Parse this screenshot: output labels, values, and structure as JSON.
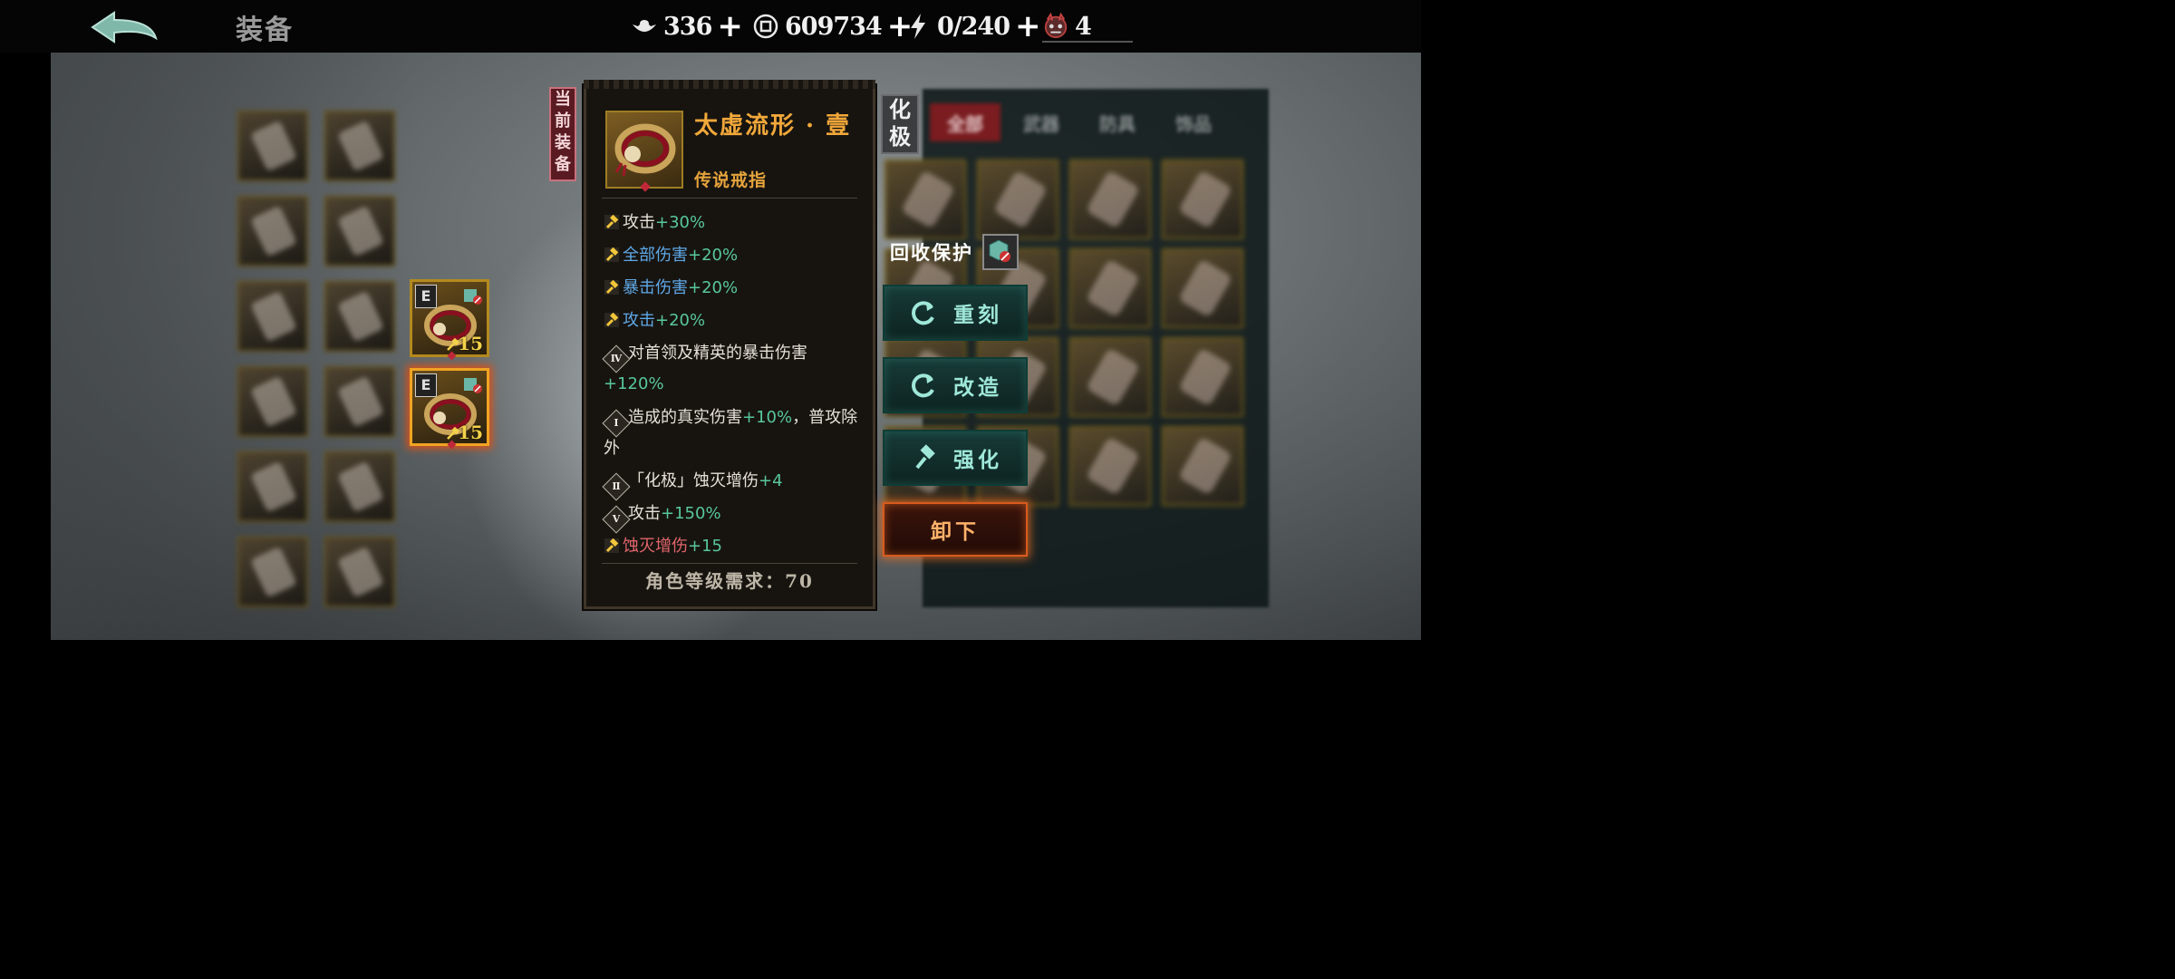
{
  "header": {
    "title": "装备",
    "resources": [
      {
        "icon": "ingot-icon",
        "value": "336",
        "plus": "+"
      },
      {
        "icon": "coin-icon",
        "value": "609734",
        "plus": "+"
      },
      {
        "icon": "lightning-icon",
        "value": "0/240",
        "plus": "+"
      },
      {
        "icon": "demon-mask-icon",
        "value": "4"
      }
    ]
  },
  "current_tag": [
    "当",
    "前",
    "装",
    "备"
  ],
  "candidates": [
    {
      "tag": "E",
      "level": "15",
      "selected": false
    },
    {
      "tag": "E",
      "level": "15",
      "selected": true
    }
  ],
  "item": {
    "name": "太虚流形 · 壹",
    "type": "传说戒指",
    "attributes": [
      {
        "kind": "hammer",
        "label": "攻击",
        "value": "+30%",
        "label_color": "white"
      },
      {
        "kind": "hammer",
        "label": "全部伤害",
        "value": "+20%",
        "label_color": "blue"
      },
      {
        "kind": "hammer",
        "label": "暴击伤害",
        "value": "+20%",
        "label_color": "blue"
      },
      {
        "kind": "hammer",
        "label": "攻击",
        "value": "+20%",
        "label_color": "blue"
      },
      {
        "kind": "rune",
        "rune": "Ⅳ",
        "label": "对首领及精英的暴击伤害",
        "value": "+120%"
      },
      {
        "kind": "rune",
        "rune": "Ⅰ",
        "label": "造成的真实伤害",
        "value": "+10%",
        "suffix": "，普攻除外"
      },
      {
        "kind": "rune",
        "rune": "Ⅱ",
        "label": "「化极」蚀灭增伤",
        "value": "+4"
      },
      {
        "kind": "rune",
        "rune": "Ⅴ",
        "label": "攻击",
        "value": "+150%"
      },
      {
        "kind": "hammer",
        "label": "蚀灭增伤",
        "value": "+15",
        "label_color": "red"
      }
    ],
    "requirement": "角色等级需求：70"
  },
  "right": {
    "badge": [
      "化",
      "极"
    ],
    "tabs": [
      "全部",
      "武器",
      "防具",
      "饰品"
    ],
    "recycle_label": "回收保护",
    "buttons": {
      "recarve": "重刻",
      "modify": "改造",
      "enhance": "强化",
      "unequip": "卸下"
    }
  },
  "colors": {
    "accent_orange": "#f2a83a",
    "stat_green": "#58c79a",
    "stat_blue": "#5fa8e6",
    "stat_red": "#e1656a",
    "button_teal": "#9fe8d9"
  }
}
